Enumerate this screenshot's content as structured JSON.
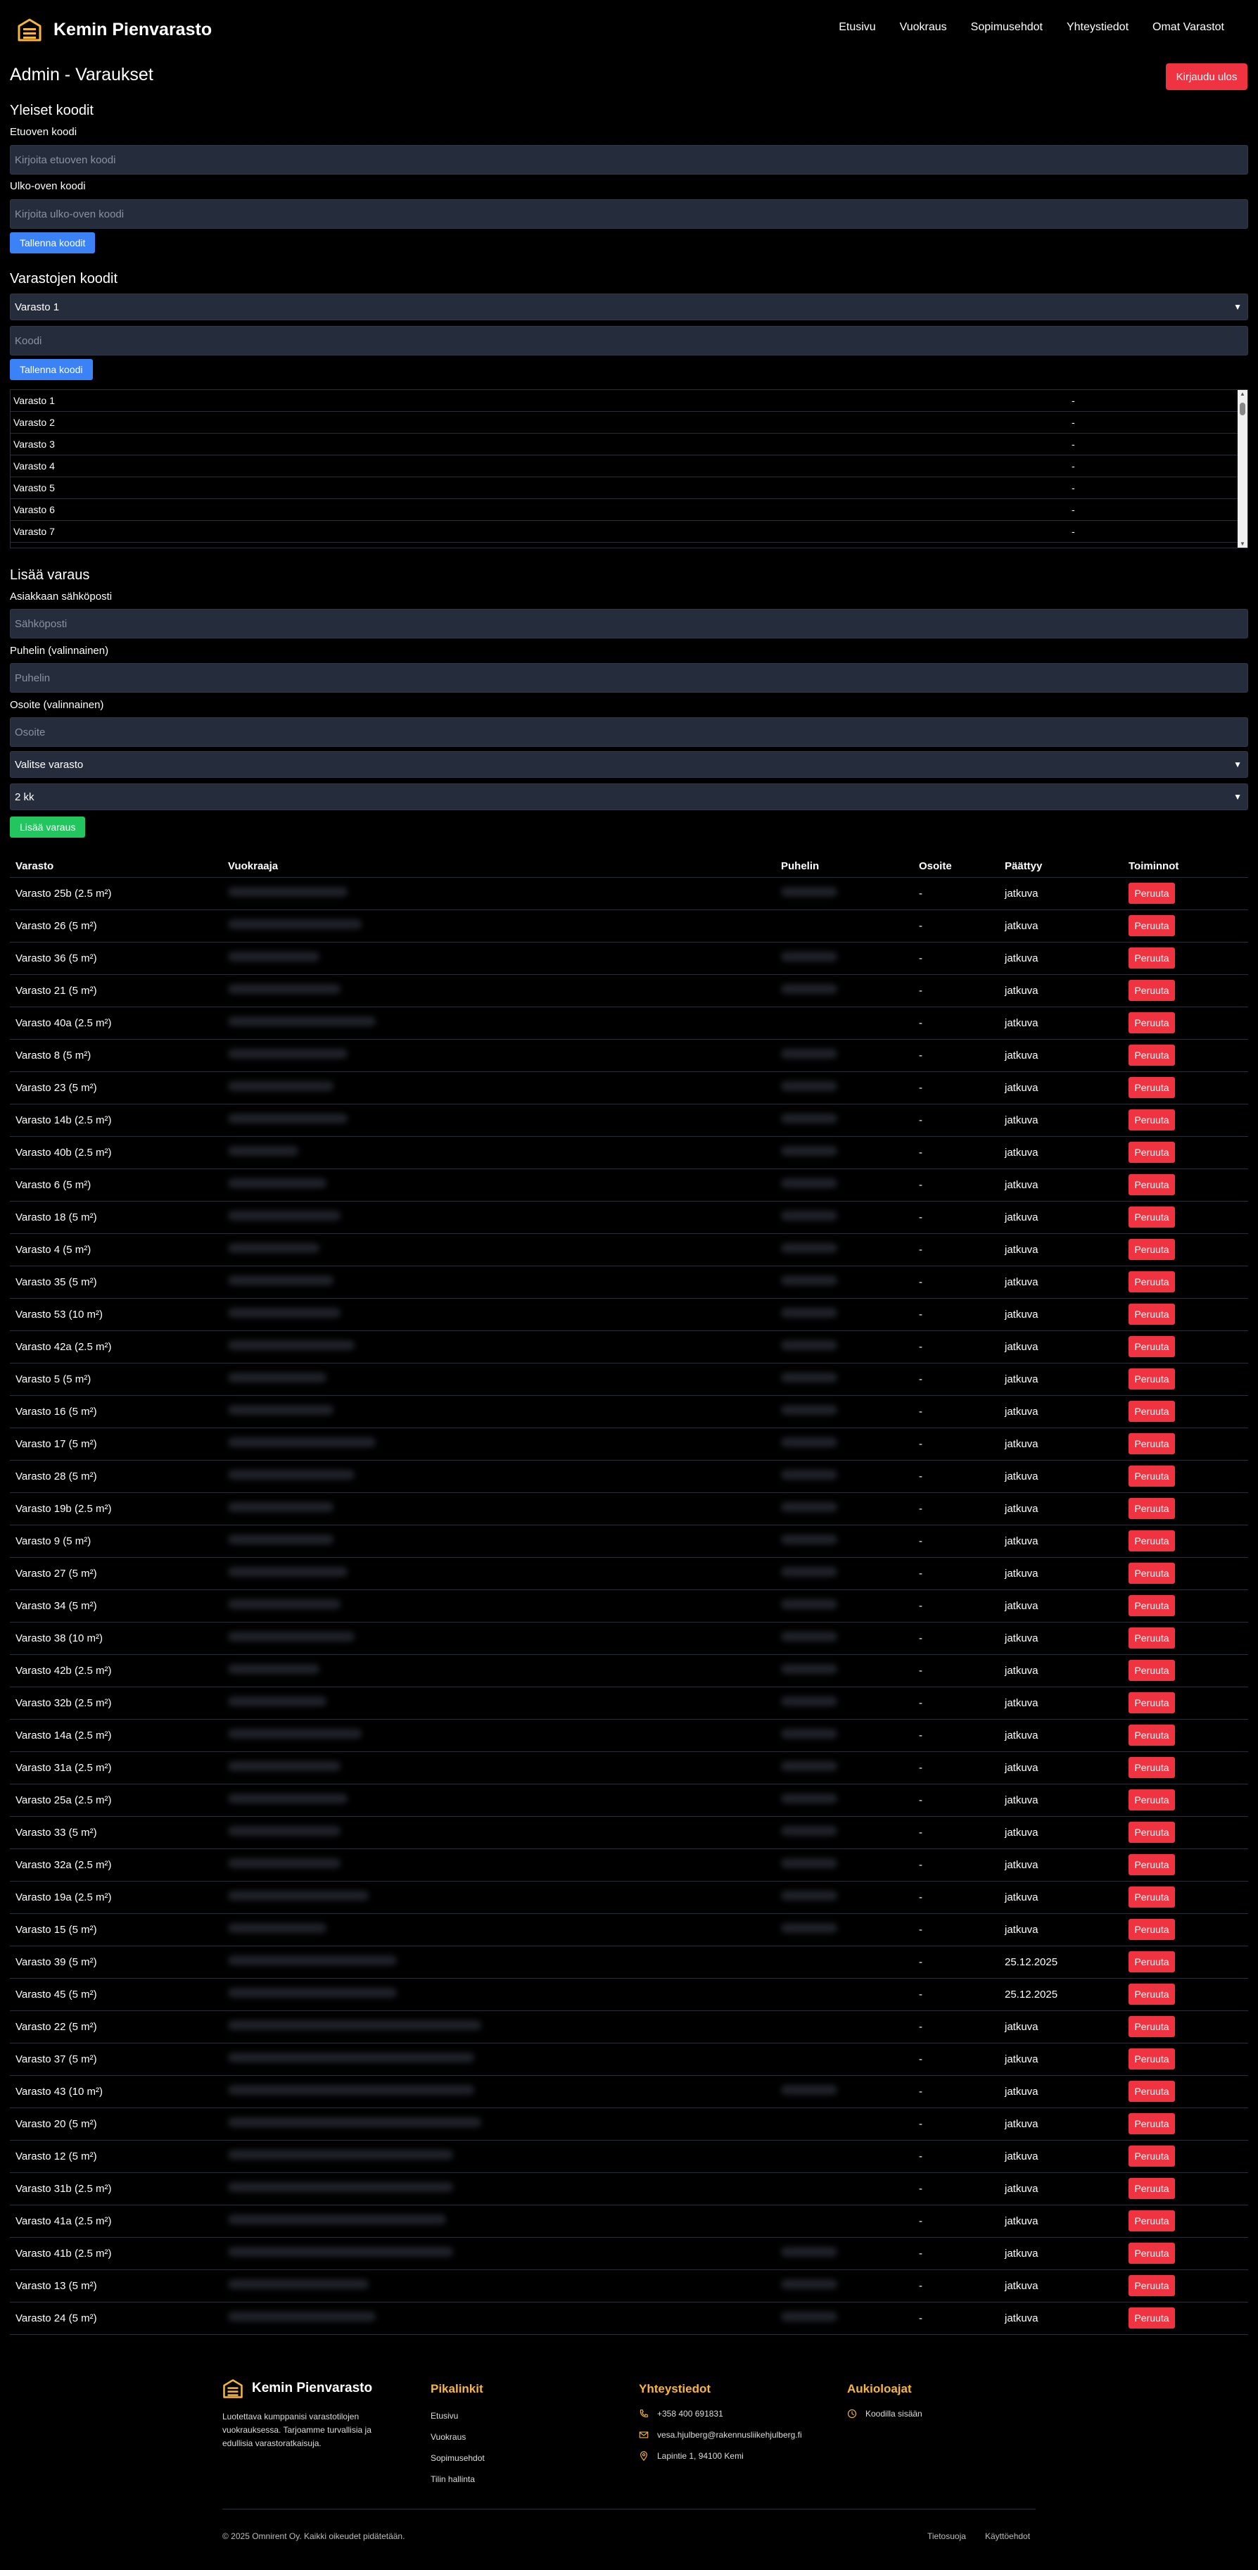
{
  "header": {
    "brand": "Kemin Pienvarasto",
    "nav": [
      "Etusivu",
      "Vuokraus",
      "Sopimusehdot",
      "Yhteystiedot",
      "Omat Varastot"
    ]
  },
  "page": {
    "title": "Admin - Varaukset",
    "logout_label": "Kirjaudu ulos"
  },
  "general_codes": {
    "heading": "Yleiset koodit",
    "front_label": "Etuoven koodi",
    "front_placeholder": "Kirjoita etuoven koodi",
    "outer_label": "Ulko-oven koodi",
    "outer_placeholder": "Kirjoita ulko-oven koodi",
    "save_label": "Tallenna koodit"
  },
  "storage_codes": {
    "heading": "Varastojen koodit",
    "selected": "Varasto 1",
    "code_placeholder": "Koodi",
    "save_label": "Tallenna koodi",
    "list": [
      {
        "name": "Varasto 1",
        "code": "-"
      },
      {
        "name": "Varasto 2",
        "code": "-"
      },
      {
        "name": "Varasto 3",
        "code": "-"
      },
      {
        "name": "Varasto 4",
        "code": "-"
      },
      {
        "name": "Varasto 5",
        "code": "-"
      },
      {
        "name": "Varasto 6",
        "code": "-"
      },
      {
        "name": "Varasto 7",
        "code": "-"
      }
    ]
  },
  "add_reservation": {
    "heading": "Lisää varaus",
    "email_label": "Asiakkaan sähköposti",
    "email_placeholder": "Sähköposti",
    "phone_label": "Puhelin (valinnainen)",
    "phone_placeholder": "Puhelin",
    "address_label": "Osoite (valinnainen)",
    "address_placeholder": "Osoite",
    "storage_select": "Valitse varasto",
    "duration_select": "2 kk",
    "submit_label": "Lisää varaus"
  },
  "reservations": {
    "columns": [
      "Varasto",
      "Vuokraaja",
      "Puhelin",
      "Osoite",
      "Päättyy",
      "Toiminnot"
    ],
    "cancel_label": "Peruuta",
    "rows": [
      {
        "storage": "Varasto 25b (2.5 m²)",
        "address": "-",
        "ends": "jatkuva"
      },
      {
        "storage": "Varasto 26 (5 m²)",
        "address": "-",
        "ends": "jatkuva"
      },
      {
        "storage": "Varasto 36 (5 m²)",
        "address": "-",
        "ends": "jatkuva"
      },
      {
        "storage": "Varasto 21 (5 m²)",
        "address": "-",
        "ends": "jatkuva"
      },
      {
        "storage": "Varasto 40a (2.5 m²)",
        "address": "-",
        "ends": "jatkuva"
      },
      {
        "storage": "Varasto 8 (5 m²)",
        "address": "-",
        "ends": "jatkuva"
      },
      {
        "storage": "Varasto 23 (5 m²)",
        "address": "-",
        "ends": "jatkuva"
      },
      {
        "storage": "Varasto 14b (2.5 m²)",
        "address": "-",
        "ends": "jatkuva"
      },
      {
        "storage": "Varasto 40b (2.5 m²)",
        "address": "-",
        "ends": "jatkuva"
      },
      {
        "storage": "Varasto 6 (5 m²)",
        "address": "-",
        "ends": "jatkuva"
      },
      {
        "storage": "Varasto 18 (5 m²)",
        "address": "-",
        "ends": "jatkuva"
      },
      {
        "storage": "Varasto 4 (5 m²)",
        "address": "-",
        "ends": "jatkuva"
      },
      {
        "storage": "Varasto 35 (5 m²)",
        "address": "-",
        "ends": "jatkuva"
      },
      {
        "storage": "Varasto 53 (10 m²)",
        "address": "-",
        "ends": "jatkuva"
      },
      {
        "storage": "Varasto 42a (2.5 m²)",
        "address": "-",
        "ends": "jatkuva"
      },
      {
        "storage": "Varasto 5 (5 m²)",
        "address": "-",
        "ends": "jatkuva"
      },
      {
        "storage": "Varasto 16 (5 m²)",
        "address": "-",
        "ends": "jatkuva"
      },
      {
        "storage": "Varasto 17 (5 m²)",
        "address": "-",
        "ends": "jatkuva"
      },
      {
        "storage": "Varasto 28 (5 m²)",
        "address": "-",
        "ends": "jatkuva"
      },
      {
        "storage": "Varasto 19b (2.5 m²)",
        "address": "-",
        "ends": "jatkuva"
      },
      {
        "storage": "Varasto 9 (5 m²)",
        "address": "-",
        "ends": "jatkuva"
      },
      {
        "storage": "Varasto 27 (5 m²)",
        "address": "-",
        "ends": "jatkuva"
      },
      {
        "storage": "Varasto 34 (5 m²)",
        "address": "-",
        "ends": "jatkuva"
      },
      {
        "storage": "Varasto 38 (10 m²)",
        "address": "-",
        "ends": "jatkuva"
      },
      {
        "storage": "Varasto 42b (2.5 m²)",
        "address": "-",
        "ends": "jatkuva"
      },
      {
        "storage": "Varasto 32b (2.5 m²)",
        "address": "-",
        "ends": "jatkuva"
      },
      {
        "storage": "Varasto 14a (2.5 m²)",
        "address": "-",
        "ends": "jatkuva"
      },
      {
        "storage": "Varasto 31a (2.5 m²)",
        "address": "-",
        "ends": "jatkuva"
      },
      {
        "storage": "Varasto 25a (2.5 m²)",
        "address": "-",
        "ends": "jatkuva"
      },
      {
        "storage": "Varasto 33 (5 m²)",
        "address": "-",
        "ends": "jatkuva"
      },
      {
        "storage": "Varasto 32a (2.5 m²)",
        "address": "-",
        "ends": "jatkuva"
      },
      {
        "storage": "Varasto 19a (2.5 m²)",
        "address": "-",
        "ends": "jatkuva"
      },
      {
        "storage": "Varasto 15 (5 m²)",
        "address": "-",
        "ends": "jatkuva"
      },
      {
        "storage": "Varasto 39 (5 m²)",
        "address": "-",
        "ends": "25.12.2025"
      },
      {
        "storage": "Varasto 45 (5 m²)",
        "address": "-",
        "ends": "25.12.2025"
      },
      {
        "storage": "Varasto 22 (5 m²)",
        "address": "-",
        "ends": "jatkuva"
      },
      {
        "storage": "Varasto 37 (5 m²)",
        "address": "-",
        "ends": "jatkuva"
      },
      {
        "storage": "Varasto 43 (10 m²)",
        "address": "-",
        "ends": "jatkuva"
      },
      {
        "storage": "Varasto 20 (5 m²)",
        "address": "-",
        "ends": "jatkuva"
      },
      {
        "storage": "Varasto 12 (5 m²)",
        "address": "-",
        "ends": "jatkuva"
      },
      {
        "storage": "Varasto 31b (2.5 m²)",
        "address": "-",
        "ends": "jatkuva"
      },
      {
        "storage": "Varasto 41a (2.5 m²)",
        "address": "-",
        "ends": "jatkuva"
      },
      {
        "storage": "Varasto 41b (2.5 m²)",
        "address": "-",
        "ends": "jatkuva"
      },
      {
        "storage": "Varasto 13 (5 m²)",
        "address": "-",
        "ends": "jatkuva"
      },
      {
        "storage": "Varasto 24 (5 m²)",
        "address": "-",
        "ends": "jatkuva"
      }
    ]
  },
  "footer": {
    "brand": "Kemin Pienvarasto",
    "description": "Luotettava kumppanisi varastotilojen vuokrauksessa. Tarjoamme turvallisia ja edullisia varastoratkaisuja.",
    "quicklinks_heading": "Pikalinkit",
    "quicklinks": [
      "Etusivu",
      "Vuokraus",
      "Sopimusehdot",
      "Tilin hallinta"
    ],
    "contact_heading": "Yhteystiedot",
    "phone": "+358 400 691831",
    "email": "vesa.hjulberg@rakennusliikehjulberg.fi",
    "address": "Lapintie 1, 94100 Kemi",
    "hours_heading": "Aukioloajat",
    "hours": "Koodilla sisään",
    "copyright": "© 2025 Omnirent Oy. Kaikki oikeudet pidätetään.",
    "privacy": "Tietosuoja",
    "terms": "Käyttöehdot"
  },
  "colors": {
    "accent_gold": "#f6b73c",
    "danger": "#ef3340",
    "primary": "#3b82f6",
    "success": "#22c55e"
  }
}
